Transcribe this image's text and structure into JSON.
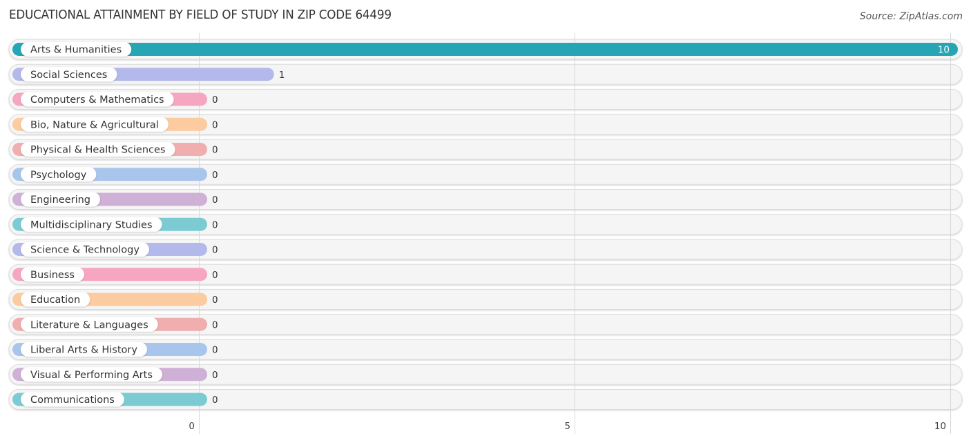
{
  "header": {
    "title": "EDUCATIONAL ATTAINMENT BY FIELD OF STUDY IN ZIP CODE 64499",
    "source": "Source: ZipAtlas.com"
  },
  "chart_data": {
    "type": "bar",
    "orientation": "horizontal",
    "title": "EDUCATIONAL ATTAINMENT BY FIELD OF STUDY IN ZIP CODE 64499",
    "xlabel": "",
    "ylabel": "",
    "xlim": [
      0,
      10
    ],
    "xticks": [
      0,
      5,
      10
    ],
    "xtick_labels": [
      "0",
      "5",
      "10"
    ],
    "grid": true,
    "categories": [
      "Arts & Humanities",
      "Social Sciences",
      "Computers & Mathematics",
      "Bio, Nature & Agricultural",
      "Physical & Health Sciences",
      "Psychology",
      "Engineering",
      "Multidisciplinary Studies",
      "Science & Technology",
      "Business",
      "Education",
      "Literature & Languages",
      "Liberal Arts & History",
      "Visual & Performing Arts",
      "Communications"
    ],
    "values": [
      10,
      1,
      0,
      0,
      0,
      0,
      0,
      0,
      0,
      0,
      0,
      0,
      0,
      0,
      0
    ],
    "value_labels": [
      "10",
      "1",
      "0",
      "0",
      "0",
      "0",
      "0",
      "0",
      "0",
      "0",
      "0",
      "0",
      "0",
      "0",
      "0"
    ],
    "colors": [
      "#26a5b5",
      "#b3b9ea",
      "#f6a6c1",
      "#fccb9f",
      "#f0aeae",
      "#a8c6ec",
      "#cfb0d6",
      "#7ccbd3",
      "#b3b9ea",
      "#f6a6c1",
      "#fccb9f",
      "#f0aeae",
      "#a8c6ec",
      "#cfb0d6",
      "#7ccbd3"
    ]
  }
}
